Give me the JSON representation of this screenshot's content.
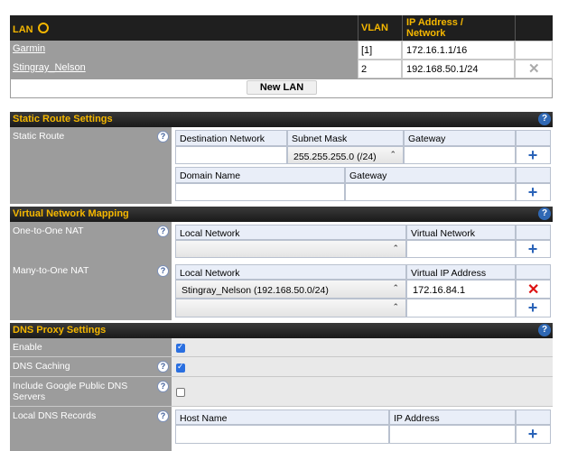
{
  "top_banner": {
    "text_before": "...",
    "link": "..."
  },
  "lan_table": {
    "headers": {
      "lan": "LAN",
      "vlan": "VLAN",
      "ip": "IP Address / Network"
    },
    "rows": [
      {
        "name": "Garmin",
        "vlan": "[1]",
        "ip": "172.16.1.1/16"
      },
      {
        "name": "Stingray_Nelson",
        "vlan": "2",
        "ip": "192.168.50.1/24"
      }
    ],
    "new_lan_button": "New LAN"
  },
  "static_route": {
    "section_title": "Static Route Settings",
    "label": "Static Route",
    "col_dest": "Destination Network",
    "col_mask": "Subnet Mask",
    "col_gateway": "Gateway",
    "mask_value": "255.255.255.0 (/24)",
    "col_domain": "Domain Name",
    "col_gateway2": "Gateway"
  },
  "vnm": {
    "section_title": "Virtual Network Mapping",
    "one_to_one_label": "One-to-One NAT",
    "o2o_col_local": "Local Network",
    "o2o_col_virtual": "Virtual Network",
    "many_to_one_label": "Many-to-One NAT",
    "m2o_col_local": "Local Network",
    "m2o_col_vip": "Virtual IP Address",
    "m2o_local_value": "Stingray_Nelson (192.168.50.0/24)",
    "m2o_vip_value": "172.16.84.1"
  },
  "dns": {
    "section_title": "DNS Proxy Settings",
    "enable_label": "Enable",
    "caching_label": "DNS Caching",
    "google_label": "Include Google Public DNS Servers",
    "local_records_label": "Local DNS Records",
    "col_host": "Host Name",
    "col_ip": "IP Address",
    "enable_checked": true,
    "caching_checked": true,
    "google_checked": false
  },
  "colors": {
    "accent": "#f5b700",
    "header_bg": "#1f1f1f",
    "label_bg": "#9c9c9c",
    "plus": "#2a63b8",
    "delete": "#d11111"
  }
}
